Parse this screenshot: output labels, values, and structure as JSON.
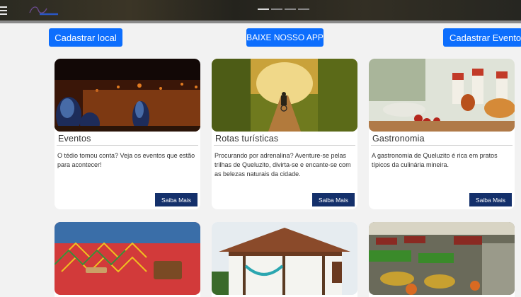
{
  "header": {
    "menu_icon": "hamburger-menu-icon",
    "logo": "site-logo",
    "carousel_slides": 4,
    "carousel_active": 1
  },
  "actions": {
    "cadastrar_local": "Cadastrar local",
    "baixe_app": "BAIXE NOSSO APP",
    "cadastrar_evento": "Cadastrar Evento"
  },
  "colors": {
    "primary_button": "#0d6efd",
    "saiba_mais": "#14306b",
    "background": "#f2f2f2"
  },
  "cards": [
    {
      "title": "Eventos",
      "description": "O tédio tomou conta? Veja os eventos que estão para acontecer!",
      "button": "Saiba Mais",
      "image": "concert-crowd-image"
    },
    {
      "title": "Rotas turísticas",
      "description": "Procurando por adrenalina? Aventure-se pelas trilhas de Queluzito, divirta-se e encante-se com as belezas naturais da cidade.",
      "button": "Saiba Mais",
      "image": "forest-trail-cyclist-image"
    },
    {
      "title": "Gastronomia",
      "description": "A gastronomia de Queluzito é rica em pratos típicos da culinária mineira.",
      "button": "Saiba Mais",
      "image": "regional-food-image"
    },
    {
      "image": "woven-handicraft-image"
    },
    {
      "image": "colonial-house-hammock-image"
    },
    {
      "image": "grocery-market-image"
    }
  ]
}
